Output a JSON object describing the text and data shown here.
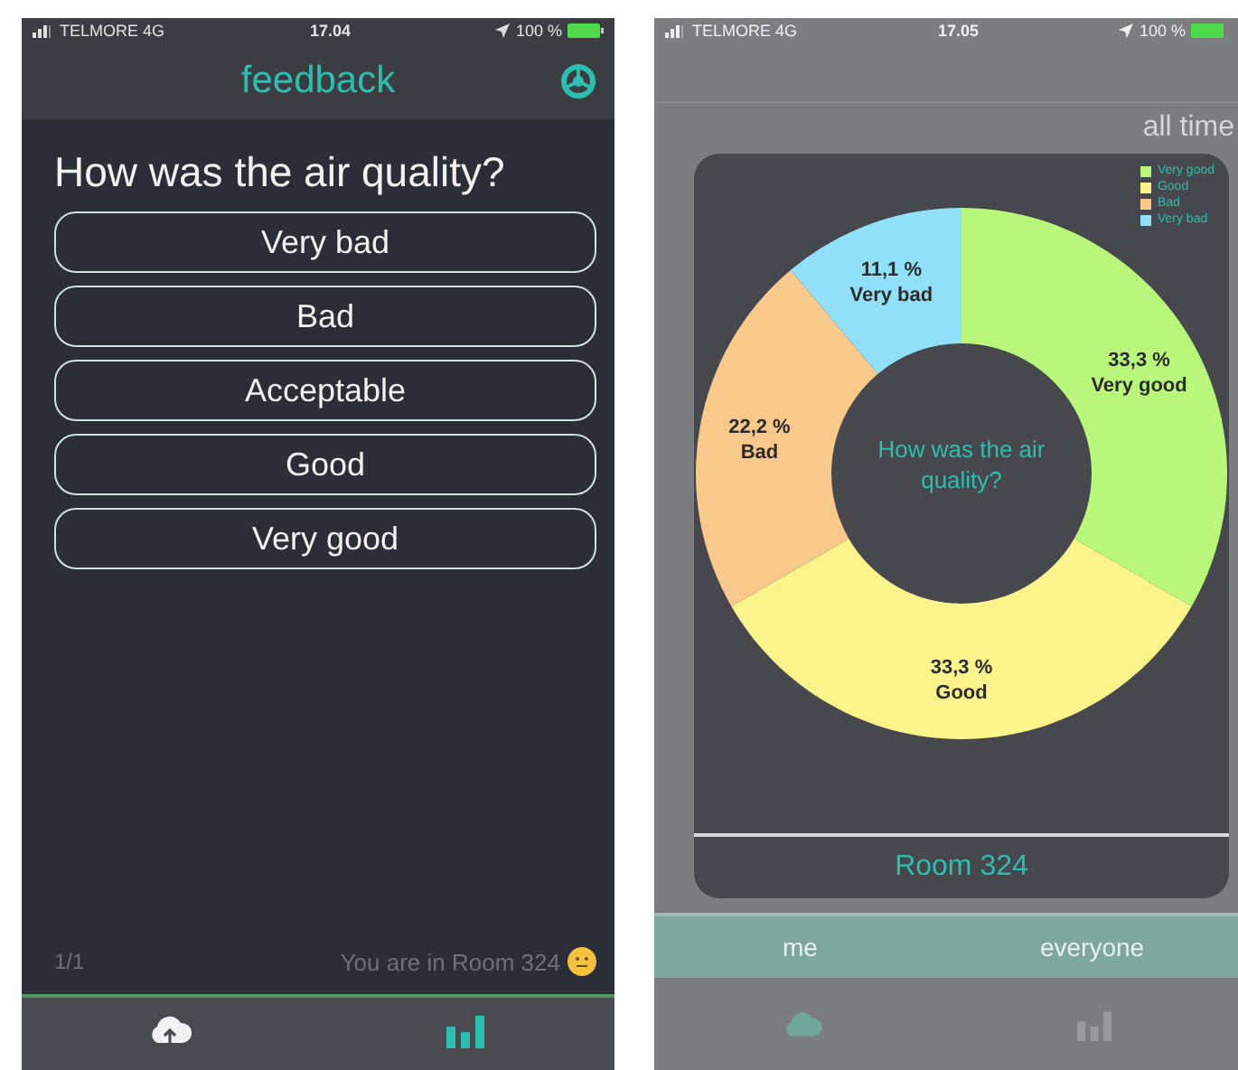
{
  "feedback_screen": {
    "status_bar": {
      "carrier": "TELMORE  4G",
      "time": "17.04",
      "battery": "100 %"
    },
    "title": "feedback",
    "question": "How was the air quality?",
    "answers": [
      "Very bad",
      "Bad",
      "Acceptable",
      "Good",
      "Very good"
    ],
    "page": "1/1",
    "room_note": "You are in Room 324",
    "tab_bar": [
      {
        "kind": "cloud",
        "selected": false
      },
      {
        "kind": "chart",
        "selected": true
      }
    ]
  },
  "stats_screen": {
    "status_bar": {
      "carrier": "TELMORE  4G",
      "time": "17.05",
      "battery": "100 %"
    },
    "period_tab": "all time",
    "legend": [
      {
        "label": "Very good",
        "color": "#b8f77a"
      },
      {
        "label": "Good",
        "color": "#fbf48a"
      },
      {
        "label": "Bad",
        "color": "#f8c98a"
      },
      {
        "label": "Very bad",
        "color": "#8fe0f8"
      }
    ],
    "chart_data": {
      "type": "donut",
      "title": "How was the air quality?",
      "categories": [
        "Very good",
        "Good",
        "Bad",
        "Very bad"
      ],
      "values": [
        33.3,
        33.3,
        22.2,
        11.1
      ],
      "value_labels": [
        "33,3 %",
        "33,3 %",
        "22,2 %",
        "11,1 %"
      ]
    },
    "room": "Room 324",
    "audience_tabs": [
      "me",
      "everyone"
    ]
  }
}
